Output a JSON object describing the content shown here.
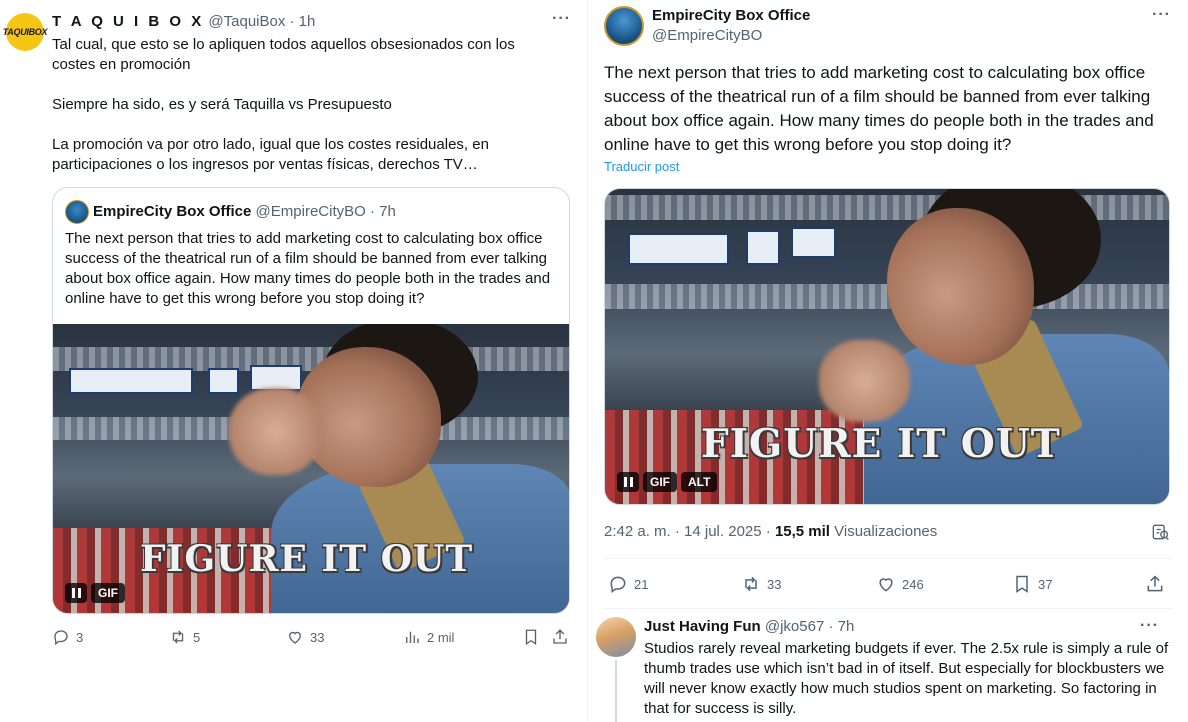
{
  "left_tweet": {
    "author_name": "T A Q U I B O X",
    "handle": "@TaquiBox",
    "time": "· 1h",
    "avatar_text": "TAQUIBOX",
    "paragraphs": [
      "Tal cual, que esto se lo apliquen todos aquellos obsesionados con los costes en promoción",
      "Siempre ha sido, es y será Taquilla vs Presupuesto",
      "La promoción va por otro lado, igual que los costes residuales, en participaciones o los ingresos por ventas físicas, derechos TV…"
    ],
    "quote": {
      "author_name": "EmpireCity Box Office",
      "handle": "@EmpireCityBO",
      "time": "· 7h",
      "text": "The next person that tries to add marketing cost to calculating box office success of the theatrical run of a film should be banned from ever talking about box office again. How many times do people both in the trades and online have to get this wrong before you stop doing it?",
      "gif_caption": "FIGURE IT OUT",
      "gif_badge": "GIF"
    },
    "actions": {
      "replies": "3",
      "reposts": "5",
      "likes": "33",
      "views": "2 mil"
    }
  },
  "right_tweet": {
    "author_name": "EmpireCity Box Office",
    "handle": "@EmpireCityBO",
    "text": "The next person that tries to add marketing cost to calculating box office success of the theatrical run of a film should be banned from ever talking about box office again. How many times do people both in the trades and online have to get this wrong before you stop doing it?",
    "translate_label": "Traducir post",
    "gif_caption": "FIGURE IT OUT",
    "gif_badge": "GIF",
    "alt_badge": "ALT",
    "timestamp": "2:42 a. m. · 14 jul. 2025 · ",
    "views_count": "15,5 mil",
    "views_label": " Visualizaciones",
    "actions": {
      "replies": "21",
      "reposts": "33",
      "likes": "246",
      "bookmarks": "37"
    }
  },
  "reply": {
    "author_name": "Just Having Fun",
    "handle": "@jko567",
    "time": "· 7h",
    "text": "Studios rarely reveal marketing budgets if ever. The 2.5x rule is simply a rule of thumb trades use which isn’t bad in of itself. But especially for blockbusters we will never know exactly how much studios spent on marketing. So factoring in that for success is silly."
  },
  "colors": {
    "accent": "#1d9bf0",
    "muted": "#536471",
    "border": "#cfd9de",
    "taquibox_yellow": "#f7c514"
  },
  "icons": [
    "more-icon",
    "reply-icon",
    "repost-icon",
    "like-icon",
    "views-icon",
    "bookmark-icon",
    "share-icon",
    "analytics-icon",
    "pause-icon"
  ]
}
